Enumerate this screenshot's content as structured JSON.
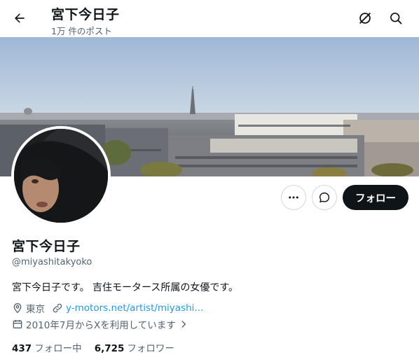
{
  "header": {
    "title": "宮下今日子",
    "post_count": "1万 件のポスト"
  },
  "profile": {
    "name": "宮下今日子",
    "handle": "@miyashitakyoko",
    "bio": "宮下今日子です。 吉住モータース所属の女優です。",
    "location": "東京",
    "website": "y-motors.net/artist/miyashi...",
    "joined": "2010年7月からXを利用しています",
    "follow_label": "フォロー",
    "following_count": "437",
    "following_label": "フォロー中",
    "followers_count": "6,725",
    "followers_label": "フォロワー"
  },
  "icons": {
    "back": "arrow-left-icon",
    "grok": "grok-icon",
    "search": "search-icon",
    "more": "more-dots-icon",
    "message": "message-icon",
    "location": "location-pin-icon",
    "link": "link-icon",
    "calendar": "calendar-icon",
    "chevron": "chevron-right-icon"
  },
  "colors": {
    "link": "#1d9bf0",
    "muted": "#536471",
    "primary_button": "#0f1419"
  }
}
